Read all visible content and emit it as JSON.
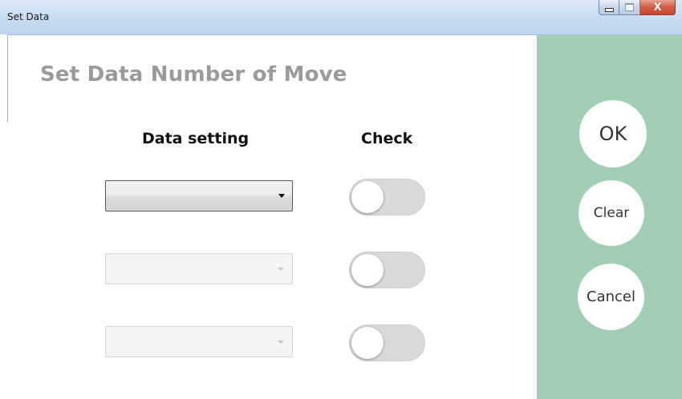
{
  "window": {
    "title": "Set Data",
    "close_glyph": "X"
  },
  "main": {
    "heading": "Set Data Number of Move",
    "columns": {
      "data_setting": "Data setting",
      "check": "Check"
    },
    "rows": [
      {
        "select_value": "",
        "select_enabled": true,
        "check_on": false
      },
      {
        "select_value": "",
        "select_enabled": false,
        "check_on": false
      },
      {
        "select_value": "",
        "select_enabled": false,
        "check_on": false
      }
    ]
  },
  "side_panel": {
    "ok_label": "OK",
    "clear_label": "Clear",
    "cancel_label": "Cancel"
  },
  "colors": {
    "side_panel_bg": "#a1cdb3",
    "heading_text": "#9a9a9a",
    "toggle_off": "#d9d9d9"
  }
}
